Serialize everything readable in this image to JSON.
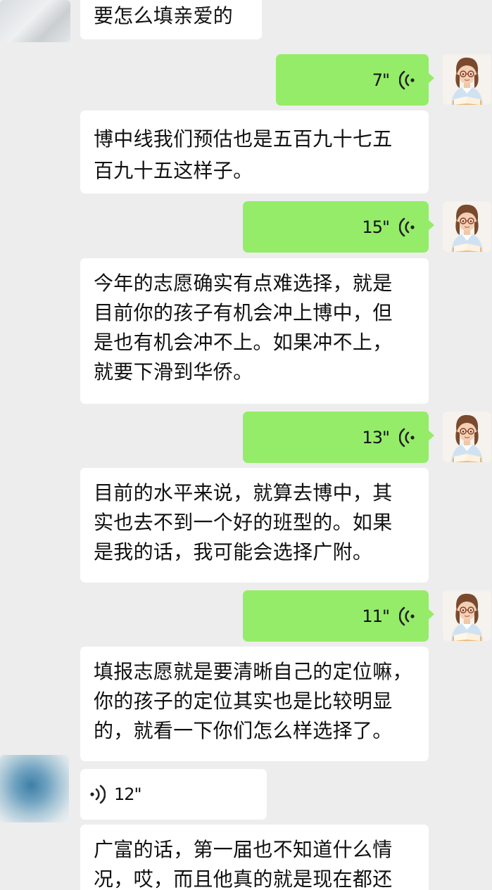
{
  "colors": {
    "background": "#ededed",
    "incoming_bubble": "#ffffff",
    "outgoing_bubble": "#95ec69"
  },
  "messages": [
    {
      "type": "text-in",
      "text": "要怎么填亲爱的"
    },
    {
      "type": "voice-out",
      "duration": "7\""
    },
    {
      "type": "text-in",
      "lines": [
        "博中线我们预估也是五百九十七五",
        "百九十五这样子。"
      ]
    },
    {
      "type": "voice-out",
      "duration": "15\""
    },
    {
      "type": "text-in",
      "lines": [
        "今年的志愿确实有点难选择，就是",
        "目前你的孩子有机会冲上博中，但",
        "是也有机会冲不上。如果冲不上，",
        "就要下滑到华侨。"
      ]
    },
    {
      "type": "voice-out",
      "duration": "13\""
    },
    {
      "type": "text-in",
      "lines": [
        "目前的水平来说，就算去博中，其",
        "实也去不到一个好的班型的。如果",
        "是我的话，我可能会选择广附。"
      ]
    },
    {
      "type": "voice-out",
      "duration": "11\""
    },
    {
      "type": "text-in",
      "lines": [
        "填报志愿就是要清晰自己的定位嘛，",
        "你的孩子的定位其实也是比较明显",
        "的，就看一下你们怎么样选择了。"
      ]
    },
    {
      "type": "voice-in",
      "duration": "12\""
    },
    {
      "type": "text-in",
      "lines": [
        "广富的话，第一届也不知道什么情",
        "况，哎，而且他真的就是现在都还"
      ]
    }
  ],
  "icons": {
    "voice_outgoing": "voice-wave-icon",
    "voice_incoming": "voice-wave-icon",
    "teacher_avatar": "teacher-avatar",
    "user_avatar": "user-avatar"
  }
}
